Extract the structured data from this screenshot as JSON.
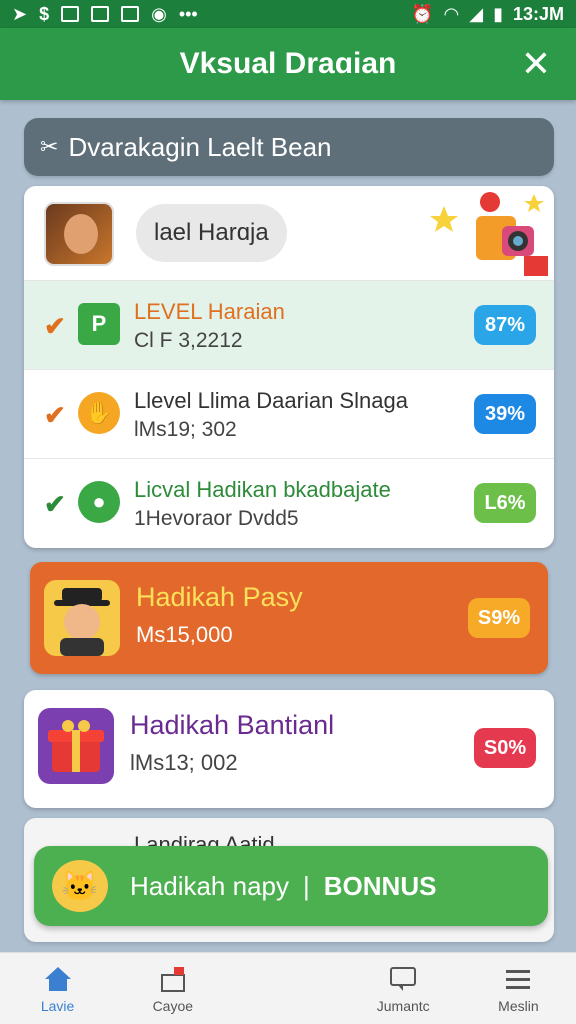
{
  "status_bar": {
    "time": "13:JM"
  },
  "app_bar": {
    "title": "Vksual Draɑian",
    "close_glyph": "✕"
  },
  "search": {
    "text": "Dvarakagin Laelt Bean"
  },
  "header_card": {
    "pill": "lael Harɑja"
  },
  "levels": [
    {
      "title": "LEVEL Haraian",
      "sub": "Cl F 3,2212",
      "badge": "87%",
      "title_color": "#e07020",
      "check_color": "#e07020",
      "badge_color": "#2aa6e8",
      "icon": "P",
      "icon_color": "#3aa845"
    },
    {
      "title": "Llevel Llima Daarian Slnaga",
      "sub": "lMs19; 302",
      "badge": "39%",
      "title_color": "#333333",
      "check_color": "#e07020",
      "badge_color": "#1e88e5",
      "icon": "",
      "icon_color": "#f5a623"
    },
    {
      "title": "Licval Hadikan bkadbajate",
      "sub": "1Hevoraor Dvdd5",
      "badge": "L6%",
      "title_color": "#2e8b3a",
      "check_color": "#2e8b3a",
      "badge_color": "#6cc04a",
      "icon": "",
      "icon_color": "#3aa845"
    }
  ],
  "rewards": [
    {
      "title": "Hadikah Pasy",
      "sub": "Ms15,000",
      "badge": "S9%",
      "badge_color": "#f7a928"
    },
    {
      "title": "Hadikah Bantianl",
      "sub": "lMs13; 002",
      "badge": "S0%",
      "badge_color": "#e53950"
    }
  ],
  "partial": {
    "title": "Landirag Aatid"
  },
  "toast": {
    "text": "Hadikah napy",
    "separator": "|",
    "bonus": "BONNUS"
  },
  "nav": [
    {
      "label": "Lavie",
      "icon": "home-icon"
    },
    {
      "label": "Cayoe",
      "icon": "gift-icon"
    },
    {
      "label": "",
      "icon": ""
    },
    {
      "label": "Jumantc",
      "icon": "chat-icon"
    },
    {
      "label": "Meslin",
      "icon": "menu-icon"
    }
  ]
}
